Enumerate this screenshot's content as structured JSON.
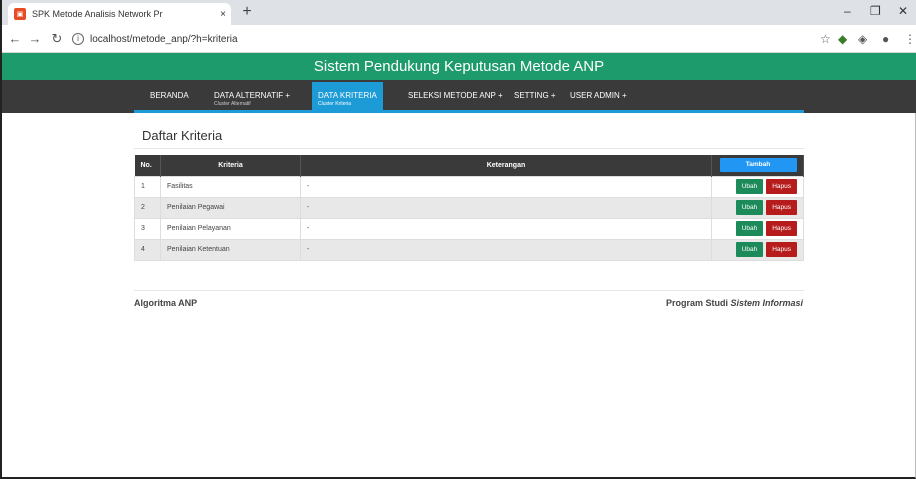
{
  "browser": {
    "tab_title": "SPK Metode Analisis Network Pr",
    "tab_close": "×",
    "new_tab": "+",
    "url": "localhost/metode_anp/?h=kriteria",
    "window_min": "–",
    "window_max": "❐",
    "window_close": "✕"
  },
  "site": {
    "header": "Sistem Pendukung Keputusan Metode ANP",
    "nav": [
      {
        "label": "BERANDA",
        "sub": ""
      },
      {
        "label": "DATA ALTERNATIF +",
        "sub": "Cluster Alternatif"
      },
      {
        "label": "DATA KRITERIA",
        "sub": "Cluster Kriteria"
      },
      {
        "label": "SELEKSI METODE ANP +",
        "sub": ""
      },
      {
        "label": "SETTING +",
        "sub": ""
      },
      {
        "label": "USER ADMIN +",
        "sub": ""
      }
    ],
    "active_nav": "DATA KRITERIA"
  },
  "content": {
    "title": "Daftar Kriteria",
    "table": {
      "headers": [
        "No.",
        "Kriteria",
        "Keterangan"
      ],
      "add_button": "Tambah",
      "rows": [
        {
          "no": "1",
          "kriteria": "Fasilitas",
          "keterangan": "-"
        },
        {
          "no": "2",
          "kriteria": "Penilaian Pegawai",
          "keterangan": "-"
        },
        {
          "no": "3",
          "kriteria": "Penilaian Pelayanan",
          "keterangan": "-"
        },
        {
          "no": "4",
          "kriteria": "Penilaian Ketentuan",
          "keterangan": "-"
        }
      ],
      "edit_label": "Ubah",
      "delete_label": "Hapus"
    }
  },
  "footer": {
    "left": "Algoritma ANP",
    "right_prefix": "Program Studi ",
    "right_em": "Sistem Informasi"
  },
  "colors": {
    "header_green": "#1d9b6c",
    "nav_dark": "#3a3a3a",
    "active_blue": "#1c9bd6",
    "edit_green": "#1d8a5a",
    "delete_red": "#b71c1c"
  }
}
